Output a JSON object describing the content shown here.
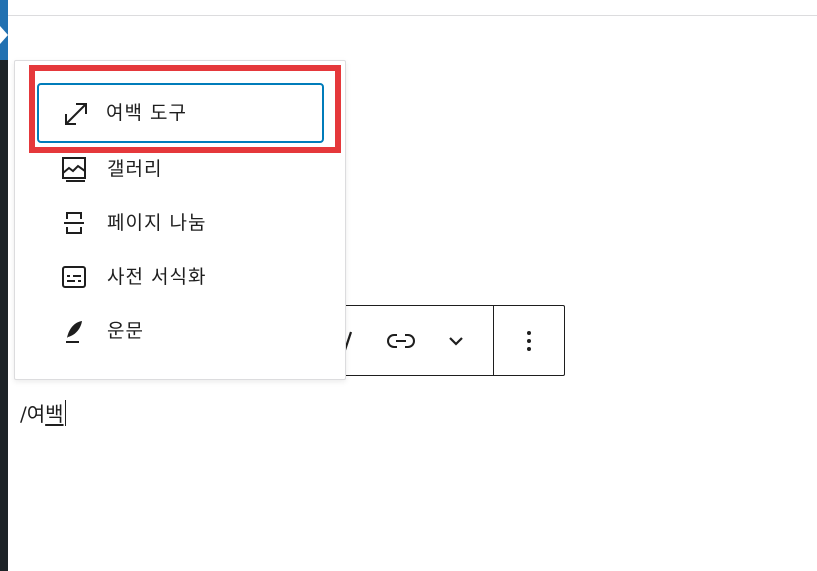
{
  "inserter": {
    "items": [
      {
        "label": "여백 도구",
        "icon": "resize-diagonal-icon",
        "selected": true
      },
      {
        "label": "갤러리",
        "icon": "gallery-icon"
      },
      {
        "label": "페이지 나눔",
        "icon": "page-break-icon"
      },
      {
        "label": "사전 서식화",
        "icon": "preformatted-icon"
      },
      {
        "label": "운문",
        "icon": "verse-feather-icon"
      }
    ]
  },
  "toolbar": {
    "buttons": [
      {
        "name": "italic",
        "icon": "italic-icon"
      },
      {
        "name": "link",
        "icon": "link-icon"
      },
      {
        "name": "more-formatting",
        "icon": "chevron-down-icon"
      },
      {
        "name": "options",
        "icon": "more-vertical-icon"
      }
    ]
  },
  "editor": {
    "paragraph_text": "/여",
    "composing_text": "백"
  },
  "colors": {
    "highlight": "#e5383b",
    "selection": "#007cba",
    "sidebar": "#1d2327",
    "sidebar_accent": "#2271b1"
  }
}
